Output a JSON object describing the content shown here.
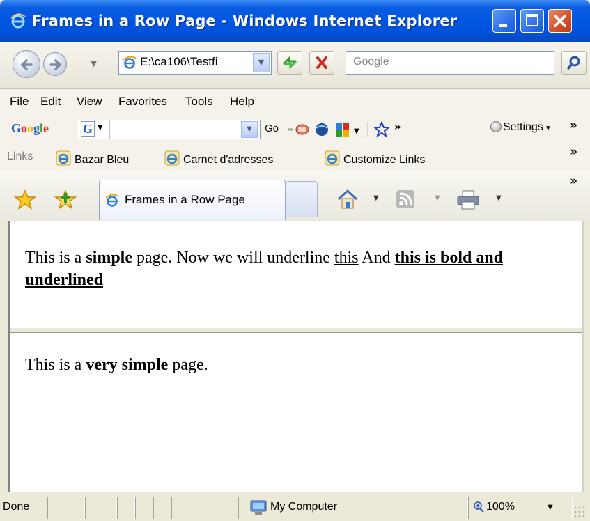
{
  "window": {
    "title": "Frames in a Row Page - Windows Internet Explorer"
  },
  "address_bar": {
    "url": "E:\\ca106\\Testfi",
    "search_placeholder": "Google"
  },
  "menu": {
    "items": [
      "File",
      "Edit",
      "View",
      "Favorites",
      "Tools",
      "Help"
    ]
  },
  "google_toolbar": {
    "logo": "Google",
    "go_label": "Go",
    "settings_label": "Settings",
    "overflow": "»"
  },
  "links_bar": {
    "label": "Links",
    "links": [
      "Bazar Bleu",
      "Carnet d'adresses",
      "Customize Links"
    ],
    "overflow": "»"
  },
  "tabs": {
    "active_tab_label": "Frames in a Row Page",
    "overflow": "»"
  },
  "frames": {
    "top": {
      "t1": "This is a ",
      "b1": "simple",
      "t2": " page. Now we will underline ",
      "u1": "this",
      "t3": " And ",
      "bu1": "this is bold and underlined"
    },
    "bottom": {
      "t1": "This is a ",
      "b1": "very simple",
      "t2": " page."
    }
  },
  "status_bar": {
    "status": "Done",
    "zone": "My Computer",
    "zoom": "100%"
  },
  "colors": {
    "titlebar": "#0055e3",
    "close_button": "#d9512b",
    "chrome": "#ece9d8"
  }
}
